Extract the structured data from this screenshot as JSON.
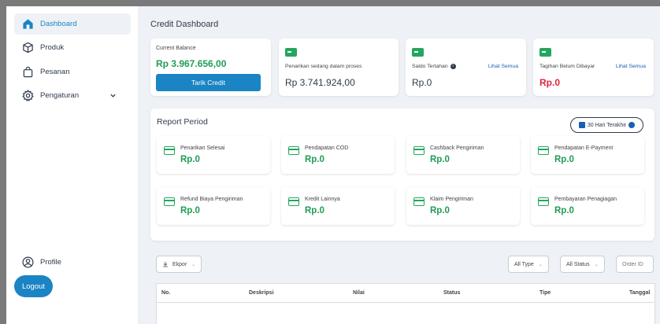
{
  "sidebar": {
    "items": [
      {
        "label": "Dashboard",
        "icon": "home-icon",
        "active": true
      },
      {
        "label": "Produk",
        "icon": "box-icon"
      },
      {
        "label": "Pesanan",
        "icon": "shopping-bag-icon"
      },
      {
        "label": "Pengaturan",
        "icon": "gear-icon",
        "has_submenu": true
      }
    ],
    "profile_label": "Profile",
    "logout_label": "Logout"
  },
  "header": {
    "title": "Credit Dashboard"
  },
  "balance": {
    "label": "Current Balance",
    "value": "Rp 3.967.656,00",
    "button_label": "Tarik Credit"
  },
  "summary_cards": [
    {
      "label": "Penarikan sedang dalam proses",
      "value": "Rp 3.741.924,00"
    },
    {
      "label": "Saldo Tertahan",
      "value": "Rp.0",
      "link": "Lihat Semua",
      "info": true
    },
    {
      "label": "Tagihan Belum Dibayar",
      "value": "Rp.0",
      "link": "Lihat Semua",
      "value_color": "red"
    }
  ],
  "report": {
    "title": "Report Period",
    "date_button": "30 Hari Terakhir",
    "stats": [
      {
        "label": "Penarikan Selesai",
        "value": "Rp.0"
      },
      {
        "label": "Pendapatan COD",
        "value": "Rp.0"
      },
      {
        "label": "Cashback Pengiriman",
        "value": "Rp.0"
      },
      {
        "label": "Pendapatan E-Payment",
        "value": "Rp.0"
      },
      {
        "label": "Refund Biaya Pengiriman",
        "value": "Rp.0"
      },
      {
        "label": "Kredit Lainnya",
        "value": "Rp.0"
      },
      {
        "label": "Klaim Pengiriman",
        "value": "Rp.0"
      },
      {
        "label": "Pembayaran Penagiagan",
        "value": "Rp.0"
      }
    ]
  },
  "toolbar": {
    "export_label": "Ekpor",
    "type_filter": "All Type",
    "status_filter": "All Status",
    "search_placeholder": "Order ID"
  },
  "table": {
    "columns": [
      "No.",
      "Deskripsi",
      "Nilai",
      "Status",
      "Tipe",
      "Tanggal"
    ]
  },
  "colors": {
    "primary": "#1a84c4",
    "positive": "#1f9d55",
    "negative": "#e0263b"
  }
}
